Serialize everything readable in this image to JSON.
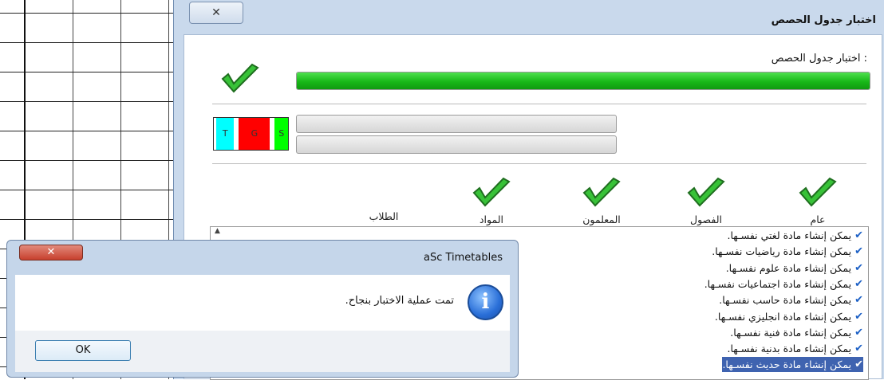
{
  "main_dialog": {
    "title": "اختبار جدول الحصص",
    "close_glyph": "✕",
    "section_label": "اختبار جدول الحصص :",
    "overall_progress": 1.0,
    "sub_progress": [
      0,
      0
    ],
    "swatches": [
      {
        "text": "S",
        "color": "#00ff00"
      },
      {
        "text": "G",
        "color": "#ff0000"
      },
      {
        "text": "T",
        "color": "#00ffff"
      }
    ],
    "tabs": [
      "عام",
      "الفصول",
      "المعلمون",
      "المواد",
      "الطلاب"
    ],
    "list_items": [
      "يمكن إنشاء مادة لغتي نفسـها.",
      "يمكن إنشاء مادة رياضيات نفسـها.",
      "يمكن إنشاء مادة علوم نفسـها.",
      "يمكن إنشاء مادة اجتماعيات نفسـها.",
      "يمكن إنشاء مادة حاسب نفسـها.",
      "يمكن إنشاء مادة انجليزي نفسـها.",
      "يمكن إنشاء مادة فنية نفسـها.",
      "يمكن إنشاء مادة بدنية نفسـها.",
      "يمكن إنشاء مادة حديث نفسـها."
    ],
    "selected_index": 8,
    "check_glyph": "✔"
  },
  "message_box": {
    "title": "aSc Timetables",
    "close_glyph": "✕",
    "message": "تمت عملية الاختبار بنجاح.",
    "ok_label": "OK",
    "icon_glyph": "i"
  },
  "icons": {
    "check": "check-icon",
    "info": "info-icon",
    "close": "close-icon"
  }
}
